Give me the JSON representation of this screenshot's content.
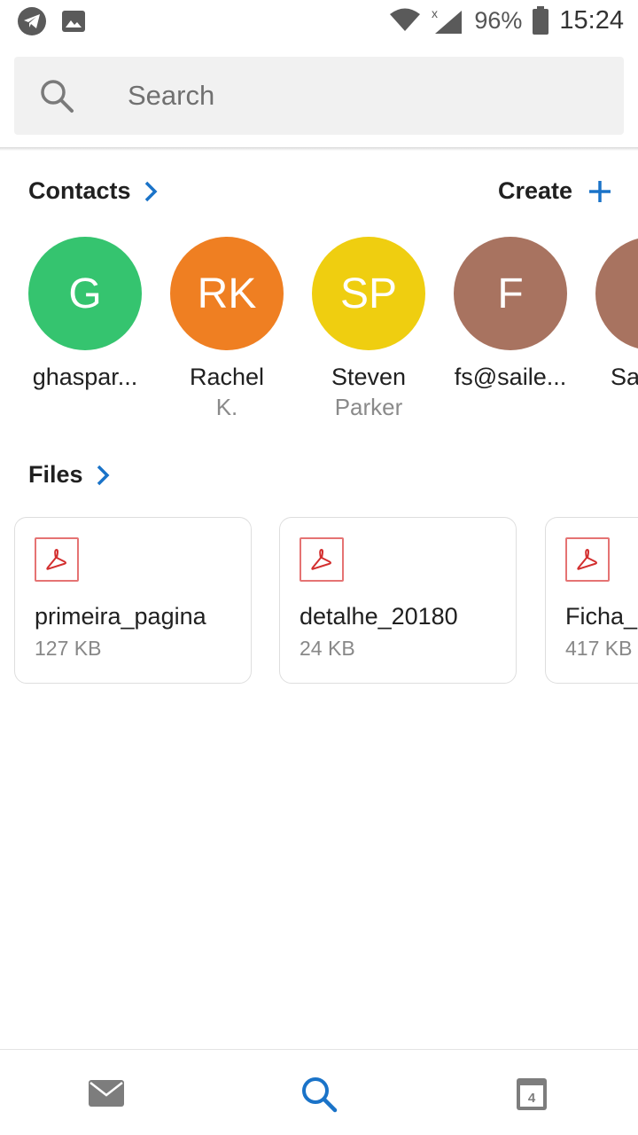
{
  "status_bar": {
    "battery": "96%",
    "time": "15:24"
  },
  "search": {
    "placeholder": "Search"
  },
  "contacts": {
    "title": "Contacts",
    "create_label": "Create",
    "items": [
      {
        "initials": "G",
        "name": "ghaspar...",
        "sub": "",
        "color": "#35c46f"
      },
      {
        "initials": "RK",
        "name": "Rachel",
        "sub": "K.",
        "color": "#ef7f22"
      },
      {
        "initials": "SP",
        "name": "Steven",
        "sub": "Parker",
        "color": "#efce10"
      },
      {
        "initials": "F",
        "name": "fs@saile...",
        "sub": "",
        "color": "#a87360"
      },
      {
        "initials": "",
        "name": "Sa",
        "sub": "",
        "color": "#a87360"
      }
    ]
  },
  "files": {
    "title": "Files",
    "items": [
      {
        "name": "primeira_pagina",
        "size": "127 KB"
      },
      {
        "name": "detalhe_20180",
        "size": "24 KB"
      },
      {
        "name": "Ficha_",
        "size": "417 KB"
      }
    ]
  },
  "colors": {
    "accent": "#1a73c8",
    "pdf_red": "#d32f2f"
  },
  "bottom_nav": {
    "calendar_day": "4",
    "icons": [
      "mail-icon",
      "search-icon",
      "calendar-icon"
    ]
  }
}
